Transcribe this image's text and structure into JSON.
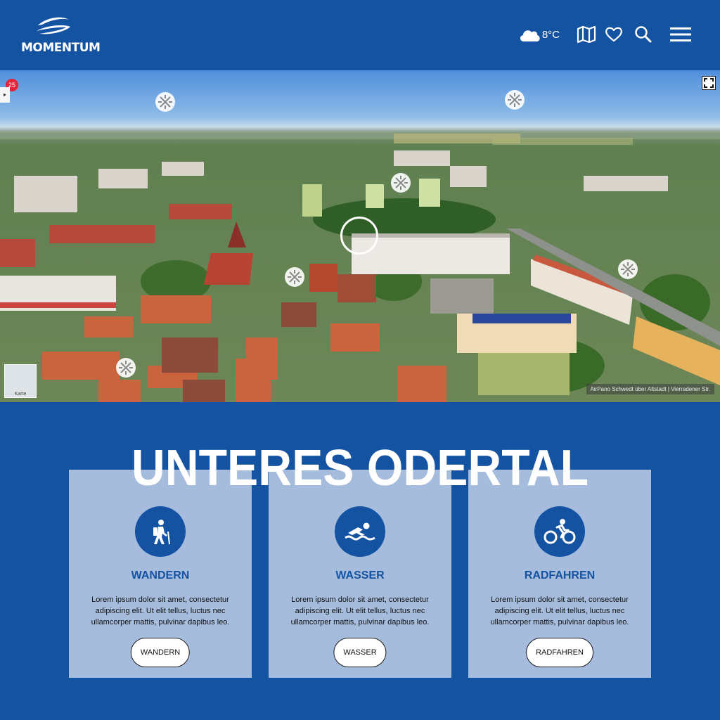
{
  "header": {
    "logo_text": "MOMENTUM",
    "weather": {
      "icon": "cloud-icon",
      "temperature": "8°C"
    },
    "icons": [
      "map-icon",
      "heart-icon",
      "search-icon",
      "menu-icon"
    ]
  },
  "panorama": {
    "badge_count": "25",
    "side_tab_glyph": "▸",
    "map_label": "Karte",
    "caption": "AirPano Schwedt über Altstadt | Vierradener Str."
  },
  "main": {
    "headline": "UNTERES ODERTAL",
    "cards": [
      {
        "icon": "hiking-icon",
        "title": "WANDERN",
        "text": "Lorem ipsum dolor sit amet, consectetur adipiscing elit. Ut elit tellus, luctus nec ullamcorper mattis, pulvinar dapibus leo.",
        "button": "WANDERN"
      },
      {
        "icon": "swimming-icon",
        "title": "WASSER",
        "text": "Lorem ipsum dolor sit amet, consectetur adipiscing elit. Ut elit tellus, luctus nec ullamcorper mattis, pulvinar dapibus leo.",
        "button": "WASSER"
      },
      {
        "icon": "cycling-icon",
        "title": "RADFAHREN",
        "text": "Lorem ipsum dolor sit amet, consectetur adipiscing elit. Ut elit tellus, luctus nec ullamcorper mattis, pulvinar dapibus leo.",
        "button": "RADFAHREN"
      }
    ]
  },
  "colors": {
    "brand": "#1452a2",
    "card_bg": "#a6bcdd",
    "badge": "#e2233a"
  }
}
